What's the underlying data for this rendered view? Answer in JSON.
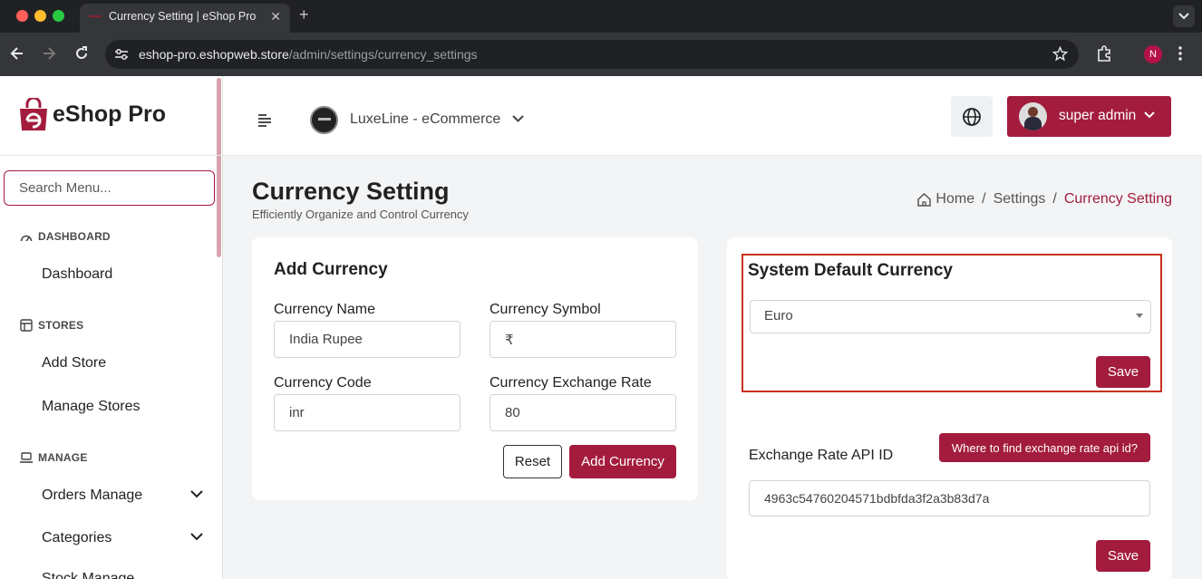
{
  "browser": {
    "tab_title": "Currency Setting | eShop Pro",
    "url_host": "eshop-pro.eshopwebstore",
    "url_host_display": "eshop-pro.eshopweb.store",
    "url_path": "/admin/settings/currency_settings",
    "profile_initial": "N"
  },
  "sidebar": {
    "brand": "eShop Pro",
    "search_placeholder": "Search Menu...",
    "sections": {
      "dashboard": {
        "heading": "DASHBOARD",
        "items": [
          "Dashboard"
        ]
      },
      "stores": {
        "heading": "STORES",
        "items": [
          "Add Store",
          "Manage Stores"
        ]
      },
      "manage": {
        "heading": "MANAGE",
        "items": [
          "Orders Manage",
          "Categories",
          "Stock Manage"
        ]
      }
    }
  },
  "header": {
    "store_name": "LuxeLine - eCommerce",
    "admin_name": "super admin"
  },
  "page": {
    "title": "Currency Setting",
    "subtitle": "Efficiently Organize and Control Currency",
    "breadcrumb": {
      "home": "Home",
      "sep": "/",
      "settings": "Settings",
      "current": "Currency Setting"
    }
  },
  "add_currency": {
    "title": "Add Currency",
    "name_label": "Currency Name",
    "name_value": "India Rupee",
    "symbol_label": "Currency Symbol",
    "symbol_value": "₹",
    "code_label": "Currency Code",
    "code_value": "inr",
    "rate_label": "Currency Exchange Rate",
    "rate_value": "80",
    "reset_label": "Reset",
    "submit_label": "Add Currency"
  },
  "system_currency": {
    "title": "System Default Currency",
    "selected": "Euro",
    "save_label": "Save",
    "api_label": "Exchange Rate API ID",
    "api_help_label": "Where to find exchange rate api id?",
    "api_value": "4963c54760204571bdbfda3f2a3b83d7a",
    "api_save_label": "Save"
  },
  "colors": {
    "brand": "#a31c3d",
    "highlight": "#c8321f"
  }
}
